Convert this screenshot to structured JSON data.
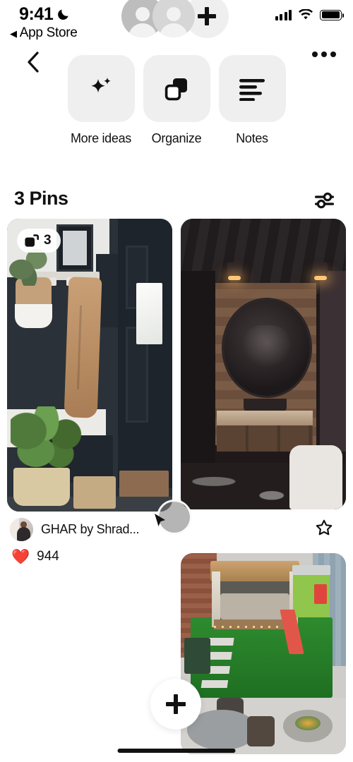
{
  "status_bar": {
    "time": "9:41",
    "dnd_icon": "crescent-moon-icon",
    "back_to_app": "App Store",
    "back_triangle": "◀",
    "signal_icon": "cellular-signal-icon",
    "wifi_icon": "wifi-icon",
    "battery_icon": "battery-full-icon"
  },
  "collaborators": {
    "avatar_one": "collaborator-avatar",
    "avatar_two": "collaborator-avatar",
    "add_label": "add-collaborator"
  },
  "nav": {
    "back_icon": "chevron-left-icon",
    "more_icon": "more-options-icon"
  },
  "actions": [
    {
      "label": "More ideas",
      "icon": "sparkle-icon"
    },
    {
      "label": "Organize",
      "icon": "organize-squares-icon"
    },
    {
      "label": "Notes",
      "icon": "notes-lines-icon"
    }
  ],
  "pins_header": {
    "title": "3 Pins",
    "filter_icon": "filter-sliders-icon"
  },
  "pins": [
    {
      "id": "pin-entryway",
      "alt": "Dark navy entryway with hanging coat, plants and framed art",
      "carousel_count": "3",
      "carousel_icon": "carousel-stack-icon",
      "user": "GHAR by Shrad...",
      "reaction_emoji": "❤️",
      "reaction_count": "944",
      "save_icon": "star-outline-icon"
    },
    {
      "id": "pin-bathroom",
      "alt": "Dark rustic bathroom with round mirror and wood panelling"
    },
    {
      "id": "pin-garden",
      "alt": "Backyard garden with pergola, artificial turf, playhouse and fire pit"
    }
  ],
  "overlay": {
    "cursor": "touch-cursor-indicator"
  },
  "fab": {
    "label": "create-pin",
    "icon": "plus-icon"
  },
  "home_indicator": "home-indicator",
  "colors": {
    "background": "#ffffff",
    "tile_gray": "#efefef",
    "text_primary": "#111111",
    "heart_red": "#e8453c"
  }
}
